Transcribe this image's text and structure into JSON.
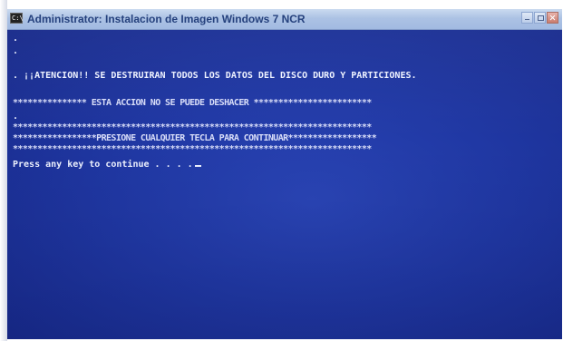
{
  "window": {
    "title": "Administrator: Instalacion de Imagen Windows 7 NCR",
    "icon_glyph": "C:\\",
    "icon_name": "cmd-icon",
    "controls": [
      "minimize",
      "maximize",
      "close"
    ]
  },
  "console": {
    "lines": [
      ".",
      ".",
      ". ¡¡ATENCION!! SE DESTRUIRAN TODOS LOS DATOS DEL DISCO DURO Y PARTICIONES.",
      "*************** ESTA ACCION NO SE PUEDE DESHACER ************************",
      ".",
      "*************************************************************************",
      "*****************PRESIONE CUALQUIER TECLA PARA CONTINUAR******************",
      "*************************************************************************",
      "Press any key to continue . . . ."
    ],
    "text_color": "#eef2ff",
    "background_color": "#1f3599"
  }
}
